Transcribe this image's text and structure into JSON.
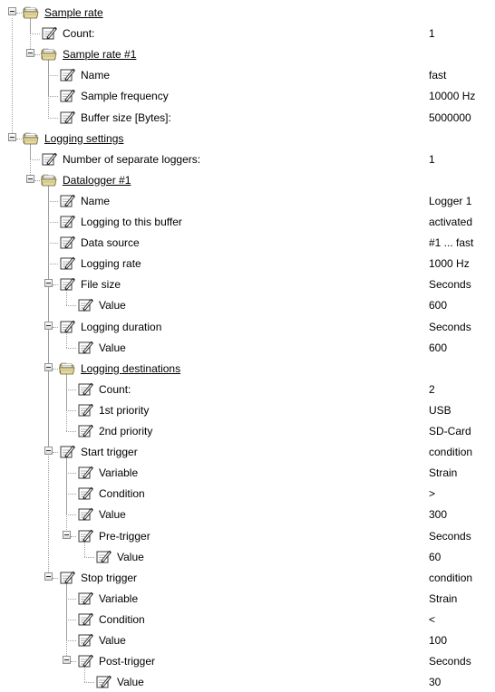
{
  "tree": {
    "rows": [
      {
        "label": "Sample rate",
        "value": "",
        "icon": "folder-icon",
        "level": 0,
        "expandable": true
      },
      {
        "label": "Count:",
        "value": "1",
        "icon": "property-icon",
        "level": 1,
        "expandable": false
      },
      {
        "label": "Sample rate #1",
        "value": "",
        "icon": "folder-icon",
        "level": 1,
        "expandable": true
      },
      {
        "label": "Name",
        "value": "fast",
        "icon": "property-icon",
        "level": 2,
        "expandable": false
      },
      {
        "label": "Sample frequency",
        "value": "10000 Hz",
        "icon": "property-icon",
        "level": 2,
        "expandable": false
      },
      {
        "label": "Buffer size [Bytes]:",
        "value": "5000000",
        "icon": "property-icon",
        "level": 2,
        "expandable": false
      },
      {
        "label": "Logging settings",
        "value": "",
        "icon": "folder-icon",
        "level": 0,
        "expandable": true
      },
      {
        "label": "Number of separate loggers:",
        "value": "1",
        "icon": "property-icon",
        "level": 1,
        "expandable": false
      },
      {
        "label": "Datalogger #1",
        "value": "",
        "icon": "folder-icon",
        "level": 1,
        "expandable": true
      },
      {
        "label": "Name",
        "value": "Logger 1",
        "icon": "property-icon",
        "level": 2,
        "expandable": false
      },
      {
        "label": "Logging to this buffer",
        "value": "activated",
        "icon": "property-icon",
        "level": 2,
        "expandable": false
      },
      {
        "label": "Data source",
        "value": "#1 ... fast",
        "icon": "property-icon",
        "level": 2,
        "expandable": false
      },
      {
        "label": "Logging rate",
        "value": "1000 Hz",
        "icon": "property-icon",
        "level": 2,
        "expandable": false
      },
      {
        "label": "File size",
        "value": "Seconds",
        "icon": "property-icon",
        "level": 2,
        "expandable": true
      },
      {
        "label": "Value",
        "value": "600",
        "icon": "property-icon",
        "level": 3,
        "expandable": false
      },
      {
        "label": "Logging duration",
        "value": "Seconds",
        "icon": "property-icon",
        "level": 2,
        "expandable": true
      },
      {
        "label": "Value",
        "value": "600",
        "icon": "property-icon",
        "level": 3,
        "expandable": false
      },
      {
        "label": "Logging destinations",
        "value": "",
        "icon": "folder-icon",
        "level": 2,
        "expandable": true
      },
      {
        "label": "Count:",
        "value": "2",
        "icon": "property-icon",
        "level": 3,
        "expandable": false
      },
      {
        "label": "1st priority",
        "value": "USB",
        "icon": "property-icon",
        "level": 3,
        "expandable": false
      },
      {
        "label": "2nd priority",
        "value": "SD-Card",
        "icon": "property-icon",
        "level": 3,
        "expandable": false
      },
      {
        "label": "Start trigger",
        "value": "condition",
        "icon": "property-icon",
        "level": 2,
        "expandable": true
      },
      {
        "label": "Variable",
        "value": "Strain",
        "icon": "property-icon",
        "level": 3,
        "expandable": false
      },
      {
        "label": "Condition",
        "value": ">",
        "icon": "property-icon",
        "level": 3,
        "expandable": false
      },
      {
        "label": "Value",
        "value": "300",
        "icon": "property-icon",
        "level": 3,
        "expandable": false
      },
      {
        "label": "Pre-trigger",
        "value": "Seconds",
        "icon": "property-icon",
        "level": 3,
        "expandable": true
      },
      {
        "label": "Value",
        "value": "60",
        "icon": "property-icon",
        "level": 4,
        "expandable": false
      },
      {
        "label": "Stop trigger",
        "value": "condition",
        "icon": "property-icon",
        "level": 2,
        "expandable": true
      },
      {
        "label": "Variable",
        "value": "Strain",
        "icon": "property-icon",
        "level": 3,
        "expandable": false
      },
      {
        "label": "Condition",
        "value": "<",
        "icon": "property-icon",
        "level": 3,
        "expandable": false
      },
      {
        "label": "Value",
        "value": "100",
        "icon": "property-icon",
        "level": 3,
        "expandable": false
      },
      {
        "label": "Post-trigger",
        "value": "Seconds",
        "icon": "property-icon",
        "level": 3,
        "expandable": true
      },
      {
        "label": "Value",
        "value": "30",
        "icon": "property-icon",
        "level": 4,
        "expandable": false
      }
    ]
  }
}
